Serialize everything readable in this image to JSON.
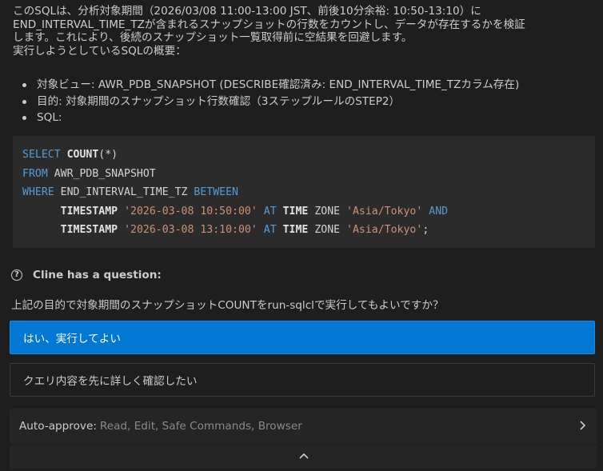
{
  "intro": {
    "line1": "このSQLは、分析対象期間（2026/03/08 11:00-13:00 JST、前後10分余裕: 10:50-13:10）に",
    "line2": "END_INTERVAL_TIME_TZが含まれるスナップショットの行数をカウントし、データが存在するかを検証",
    "line3": "します。これにより、後続のスナップショット一覧取得前に空結果を回避します。",
    "line4": "実行しようとしているSQLの概要："
  },
  "bullets": [
    "対象ビュー: AWR_PDB_SNAPSHOT (DESCRIBE確認済み: END_INTERVAL_TIME_TZカラム存在)",
    "目的: 対象期間のスナップショット行数確認（3ステップルールのSTEP2）",
    "SQL:"
  ],
  "code": {
    "l1_kw": "SELECT",
    "l1_fn": "COUNT",
    "l1_rest": "(*)",
    "l2_kw": "FROM",
    "l2_rest": "AWR_PDB_SNAPSHOT",
    "l3_kw1": "WHERE",
    "l3_rest": "END_INTERVAL_TIME_TZ",
    "l3_kw2": "BETWEEN",
    "indent": "      ",
    "ts": "TIMESTAMP",
    "l4_str1": "'2026-03-08 10:50:00'",
    "at": "AT",
    "time": "TIME",
    "zone": "ZONE",
    "tz": "'Asia/Tokyo'",
    "and": "AND",
    "l5_str1": "'2026-03-08 13:10:00'",
    "semicolon": ";"
  },
  "question": {
    "header": "Cline has a question:",
    "icon": "question-circle-icon",
    "text": "上記の目的で対象期間のスナップショットCOUNTをrun-sqlclで実行してもよいですか？"
  },
  "options": {
    "primary": "はい、実行してよい",
    "secondary": "クエリ内容を先に詳しく確認したい"
  },
  "auto_approve": {
    "label": "Auto-approve:",
    "value": "Read, Edit, Safe Commands, Browser"
  },
  "colors": {
    "background": "#1e1e1e",
    "primary_button": "#0078d4",
    "keyword": "#569cd6",
    "string": "#ce9178"
  }
}
